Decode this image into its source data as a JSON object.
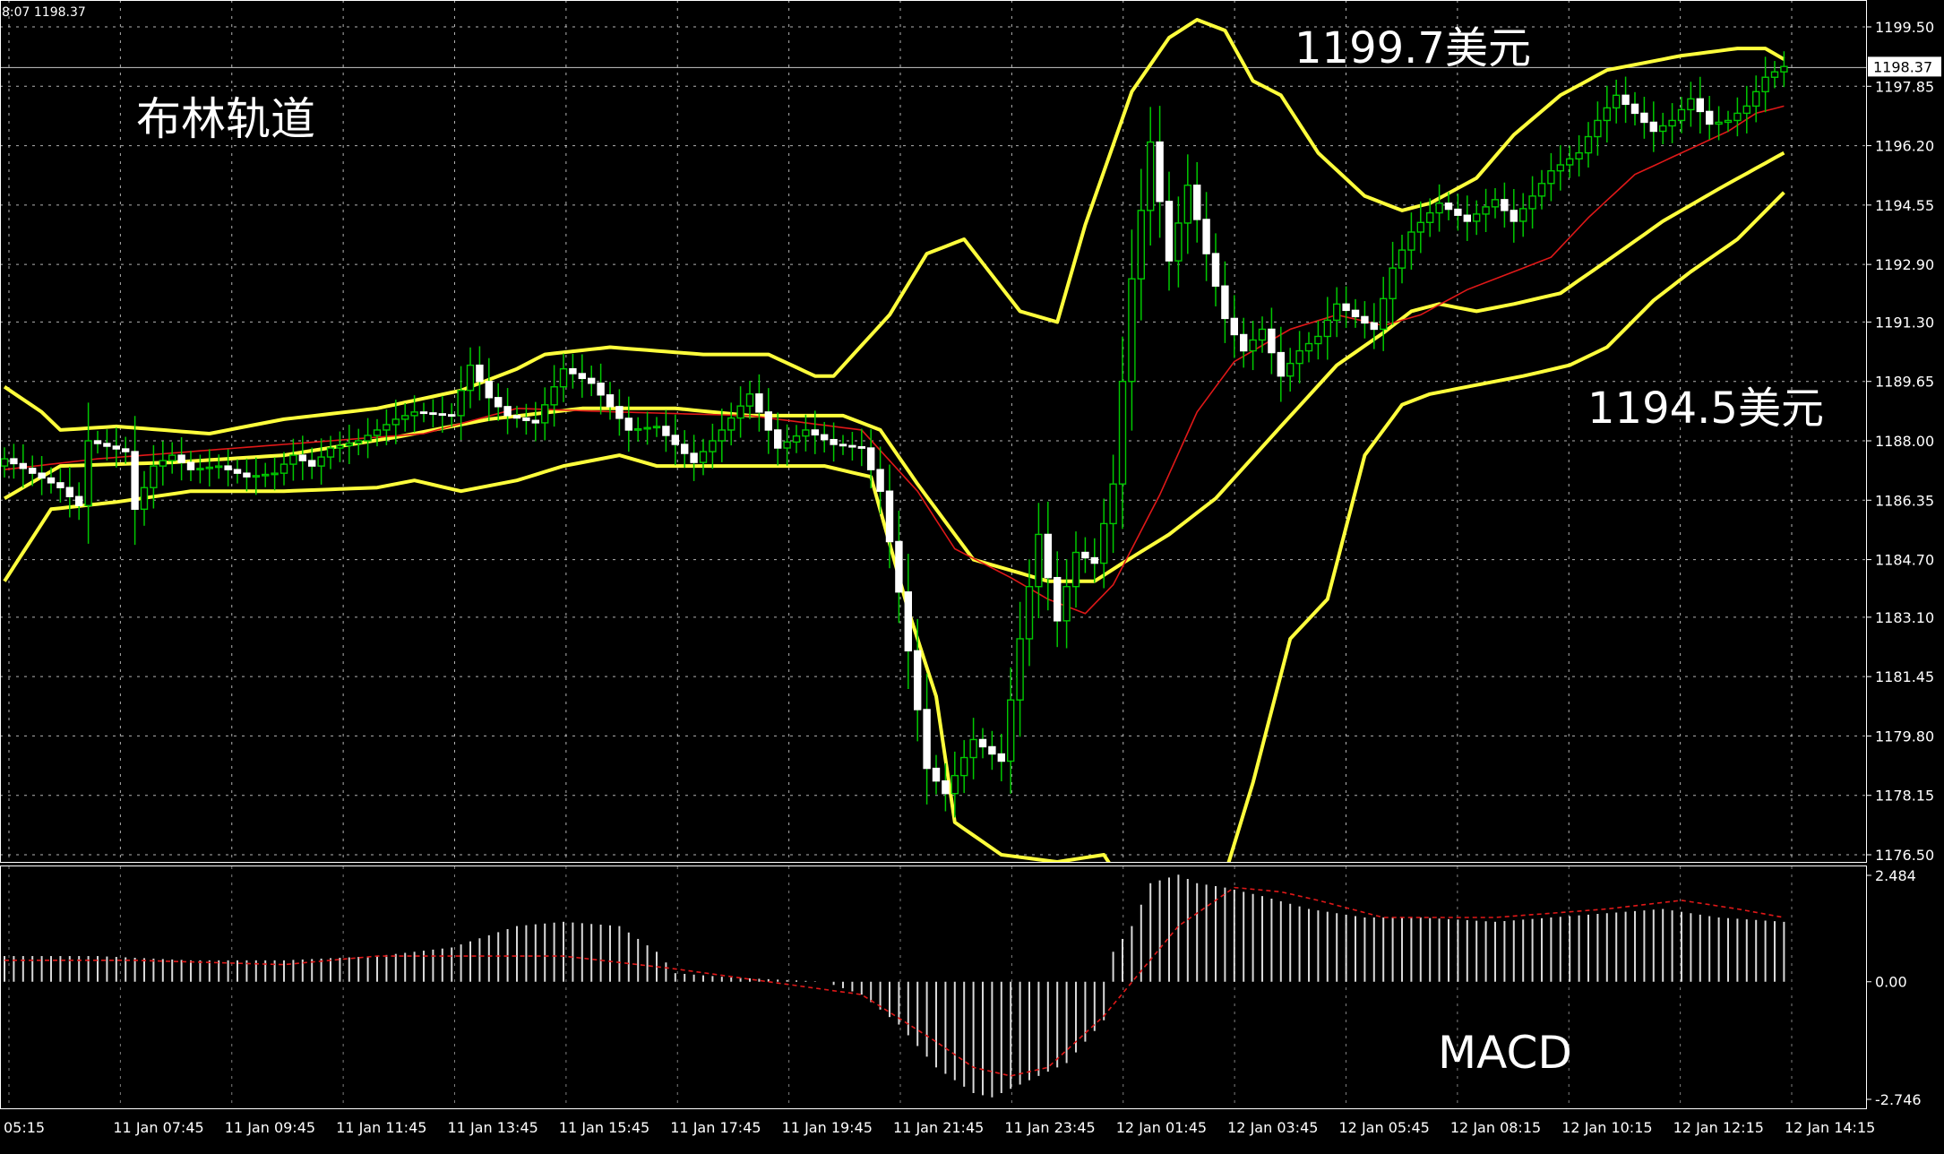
{
  "header": {
    "info": "8:07 1198.37"
  },
  "annotations": {
    "title": "布林轨道",
    "upper_label": "1199.7美元",
    "lower_label": "1194.5美元",
    "macd_label": "MACD"
  },
  "colors": {
    "background": "#000000",
    "grid": "#FFFFFF",
    "candle_up": "#00C800",
    "candle_down": "#FFFFFF",
    "bands": "#FFFF3C",
    "ma": "#E01818",
    "macd_hist": "#FFFFFF",
    "macd_signal": "#E01818",
    "axis_text": "#FFFFFF"
  },
  "chart_data": [
    {
      "type": "candlestick",
      "name": "price",
      "y_ticks": [
        "1199.50",
        "1197.85",
        "1196.20",
        "1194.55",
        "1192.90",
        "1191.30",
        "1189.65",
        "1188.00",
        "1186.35",
        "1184.70",
        "1183.10",
        "1181.45",
        "1179.80",
        "1178.15",
        "1176.50"
      ],
      "ylim": [
        1176.5,
        1199.5
      ],
      "current_price": "1198.37",
      "x_labels": [
        "05:15",
        "11 Jan 07:45",
        "11 Jan 09:45",
        "11 Jan 11:45",
        "11 Jan 13:45",
        "11 Jan 15:45",
        "11 Jan 17:45",
        "11 Jan 19:45",
        "11 Jan 21:45",
        "11 Jan 23:45",
        "12 Jan 01:45",
        "12 Jan 03:45",
        "12 Jan 05:45",
        "12 Jan 08:15",
        "12 Jan 10:15",
        "12 Jan 12:15",
        "12 Jan 14:15"
      ],
      "bands": {
        "upper_keys": [
          [
            0,
            1189.5
          ],
          [
            4,
            1188.8
          ],
          [
            6,
            1188.3
          ],
          [
            12,
            1188.4
          ],
          [
            22,
            1188.2
          ],
          [
            30,
            1188.6
          ],
          [
            40,
            1188.9
          ],
          [
            49,
            1189.4
          ],
          [
            55,
            1190.0
          ],
          [
            58,
            1190.4
          ],
          [
            65,
            1190.6
          ],
          [
            75,
            1190.4
          ],
          [
            82,
            1190.4
          ],
          [
            87,
            1189.8
          ],
          [
            89,
            1189.8
          ],
          [
            95,
            1191.5
          ],
          [
            99,
            1193.2
          ],
          [
            103,
            1193.6
          ],
          [
            109,
            1191.6
          ],
          [
            113,
            1191.3
          ],
          [
            116,
            1194.0
          ],
          [
            121,
            1197.7
          ],
          [
            125,
            1199.2
          ],
          [
            128,
            1199.7
          ],
          [
            131,
            1199.4
          ],
          [
            134,
            1198.0
          ],
          [
            137,
            1197.6
          ],
          [
            141,
            1196.0
          ],
          [
            146,
            1194.8
          ],
          [
            150,
            1194.4
          ],
          [
            153,
            1194.6
          ],
          [
            158,
            1195.3
          ],
          [
            162,
            1196.5
          ],
          [
            167,
            1197.6
          ],
          [
            172,
            1198.3
          ],
          [
            180,
            1198.7
          ],
          [
            186,
            1198.9
          ],
          [
            189,
            1198.9
          ],
          [
            191,
            1198.6
          ]
        ],
        "middle_keys": [
          [
            0,
            1186.4
          ],
          [
            6,
            1187.3
          ],
          [
            18,
            1187.4
          ],
          [
            30,
            1187.6
          ],
          [
            42,
            1188.1
          ],
          [
            52,
            1188.6
          ],
          [
            62,
            1188.9
          ],
          [
            72,
            1188.9
          ],
          [
            80,
            1188.7
          ],
          [
            90,
            1188.7
          ],
          [
            94,
            1188.3
          ],
          [
            98,
            1186.8
          ],
          [
            104,
            1184.7
          ],
          [
            112,
            1184.1
          ],
          [
            117,
            1184.1
          ],
          [
            120,
            1184.6
          ],
          [
            125,
            1185.4
          ],
          [
            130,
            1186.4
          ],
          [
            137,
            1188.4
          ],
          [
            143,
            1190.1
          ],
          [
            148,
            1191.0
          ],
          [
            151,
            1191.6
          ],
          [
            154,
            1191.8
          ],
          [
            158,
            1191.6
          ],
          [
            162,
            1191.8
          ],
          [
            167,
            1192.1
          ],
          [
            172,
            1193.0
          ],
          [
            178,
            1194.1
          ],
          [
            184,
            1195.0
          ],
          [
            191,
            1196.0
          ]
        ],
        "lower_keys": [
          [
            0,
            1184.1
          ],
          [
            5,
            1186.1
          ],
          [
            12,
            1186.3
          ],
          [
            20,
            1186.6
          ],
          [
            30,
            1186.6
          ],
          [
            40,
            1186.7
          ],
          [
            44,
            1186.9
          ],
          [
            49,
            1186.6
          ],
          [
            55,
            1186.9
          ],
          [
            60,
            1187.3
          ],
          [
            66,
            1187.6
          ],
          [
            70,
            1187.3
          ],
          [
            78,
            1187.3
          ],
          [
            88,
            1187.3
          ],
          [
            93,
            1187.0
          ],
          [
            97,
            1183.3
          ],
          [
            100,
            1180.9
          ],
          [
            102,
            1177.4
          ],
          [
            107,
            1176.5
          ],
          [
            113,
            1176.3
          ],
          [
            118,
            1176.5
          ],
          [
            121,
            1175.3
          ],
          [
            125,
            1174.9
          ],
          [
            130,
            1175.1
          ],
          [
            134,
            1178.5
          ],
          [
            138,
            1182.5
          ],
          [
            142,
            1183.6
          ],
          [
            146,
            1187.6
          ],
          [
            150,
            1189.0
          ],
          [
            153,
            1189.3
          ],
          [
            157,
            1189.5
          ],
          [
            163,
            1189.8
          ],
          [
            168,
            1190.1
          ],
          [
            172,
            1190.6
          ],
          [
            177,
            1191.9
          ],
          [
            181,
            1192.7
          ],
          [
            186,
            1193.6
          ],
          [
            191,
            1194.9
          ]
        ]
      },
      "ma_keys": [
        [
          0,
          1187.2
        ],
        [
          10,
          1187.5
        ],
        [
          30,
          1187.9
        ],
        [
          45,
          1188.2
        ],
        [
          55,
          1188.9
        ],
        [
          66,
          1188.8
        ],
        [
          80,
          1188.7
        ],
        [
          92,
          1188.3
        ],
        [
          98,
          1186.6
        ],
        [
          102,
          1185.0
        ],
        [
          108,
          1184.2
        ],
        [
          112,
          1183.6
        ],
        [
          116,
          1183.2
        ],
        [
          119,
          1184.0
        ],
        [
          124,
          1186.5
        ],
        [
          128,
          1188.8
        ],
        [
          132,
          1190.2
        ],
        [
          138,
          1191.1
        ],
        [
          143,
          1191.5
        ],
        [
          148,
          1191.2
        ],
        [
          152,
          1191.5
        ],
        [
          157,
          1192.2
        ],
        [
          162,
          1192.7
        ],
        [
          166,
          1193.1
        ],
        [
          170,
          1194.2
        ],
        [
          175,
          1195.4
        ],
        [
          180,
          1196.0
        ],
        [
          185,
          1196.6
        ],
        [
          188,
          1197.1
        ],
        [
          191,
          1197.3
        ]
      ],
      "candle_keys": [
        [
          0,
          1187.5
        ],
        [
          6,
          1186.7
        ],
        [
          8,
          1186.2
        ],
        [
          9,
          1188.0
        ],
        [
          13,
          1187.7
        ],
        [
          14,
          1186.1
        ],
        [
          16,
          1187.3
        ],
        [
          18,
          1187.6
        ],
        [
          20,
          1187.2
        ],
        [
          23,
          1187.3
        ],
        [
          26,
          1187.0
        ],
        [
          29,
          1187.1
        ],
        [
          31,
          1187.6
        ],
        [
          33,
          1187.3
        ],
        [
          35,
          1187.8
        ],
        [
          38,
          1188.0
        ],
        [
          42,
          1188.6
        ],
        [
          44,
          1188.8
        ],
        [
          48,
          1188.7
        ],
        [
          50,
          1190.1
        ],
        [
          52,
          1189.2
        ],
        [
          54,
          1188.7
        ],
        [
          57,
          1188.5
        ],
        [
          60,
          1190.0
        ],
        [
          63,
          1189.6
        ],
        [
          67,
          1188.3
        ],
        [
          70,
          1188.4
        ],
        [
          74,
          1187.4
        ],
        [
          77,
          1188.3
        ],
        [
          80,
          1189.3
        ],
        [
          83,
          1187.8
        ],
        [
          86,
          1188.3
        ],
        [
          89,
          1187.9
        ],
        [
          92,
          1187.8
        ],
        [
          94,
          1186.6
        ],
        [
          96,
          1183.8
        ],
        [
          99,
          1178.9
        ],
        [
          101,
          1178.2
        ],
        [
          104,
          1179.7
        ],
        [
          107,
          1179.1
        ],
        [
          109,
          1182.5
        ],
        [
          111,
          1185.4
        ],
        [
          113,
          1183.0
        ],
        [
          115,
          1184.9
        ],
        [
          117,
          1184.6
        ],
        [
          119,
          1186.8
        ],
        [
          121,
          1192.5
        ],
        [
          123,
          1196.3
        ],
        [
          125,
          1193.0
        ],
        [
          127,
          1195.1
        ],
        [
          129,
          1193.2
        ],
        [
          131,
          1191.4
        ],
        [
          133,
          1190.5
        ],
        [
          135,
          1191.1
        ],
        [
          137,
          1189.8
        ],
        [
          139,
          1190.5
        ],
        [
          141,
          1190.9
        ],
        [
          143,
          1191.8
        ],
        [
          147,
          1191.1
        ],
        [
          149,
          1192.8
        ],
        [
          151,
          1193.8
        ],
        [
          154,
          1194.6
        ],
        [
          157,
          1194.1
        ],
        [
          160,
          1194.7
        ],
        [
          162,
          1194.1
        ],
        [
          164,
          1194.8
        ],
        [
          166,
          1195.5
        ],
        [
          169,
          1196.0
        ],
        [
          171,
          1196.9
        ],
        [
          173,
          1197.6
        ],
        [
          175,
          1197.1
        ],
        [
          177,
          1196.6
        ],
        [
          179,
          1196.9
        ],
        [
          181,
          1197.5
        ],
        [
          183,
          1196.8
        ],
        [
          185,
          1196.9
        ],
        [
          187,
          1197.3
        ],
        [
          189,
          1198.1
        ],
        [
          191,
          1198.4
        ]
      ]
    },
    {
      "type": "bar",
      "name": "MACD",
      "y_ticks": [
        "2.484",
        "0.00",
        "-2.746"
      ],
      "ylim": [
        -2.746,
        2.484
      ],
      "hist_keys": [
        [
          0,
          0.6
        ],
        [
          10,
          0.6
        ],
        [
          20,
          0.5
        ],
        [
          30,
          0.5
        ],
        [
          40,
          0.6
        ],
        [
          48,
          0.8
        ],
        [
          55,
          1.3
        ],
        [
          60,
          1.4
        ],
        [
          66,
          1.3
        ],
        [
          70,
          0.7
        ],
        [
          72,
          0.2
        ],
        [
          78,
          0.1
        ],
        [
          88,
          0.0
        ],
        [
          92,
          -0.3
        ],
        [
          96,
          -1.0
        ],
        [
          100,
          -2.0
        ],
        [
          104,
          -2.6
        ],
        [
          106,
          -2.7
        ],
        [
          110,
          -2.3
        ],
        [
          114,
          -1.9
        ],
        [
          118,
          -0.9
        ],
        [
          119,
          0.7
        ],
        [
          121,
          1.3
        ],
        [
          123,
          2.3
        ],
        [
          126,
          2.5
        ],
        [
          128,
          2.3
        ],
        [
          131,
          2.2
        ],
        [
          135,
          2.0
        ],
        [
          140,
          1.7
        ],
        [
          146,
          1.5
        ],
        [
          152,
          1.5
        ],
        [
          160,
          1.4
        ],
        [
          166,
          1.5
        ],
        [
          172,
          1.6
        ],
        [
          178,
          1.7
        ],
        [
          184,
          1.5
        ],
        [
          191,
          1.4
        ]
      ],
      "signal_keys": [
        [
          0,
          0.5
        ],
        [
          14,
          0.5
        ],
        [
          30,
          0.4
        ],
        [
          40,
          0.6
        ],
        [
          60,
          0.6
        ],
        [
          72,
          0.3
        ],
        [
          82,
          0.0
        ],
        [
          92,
          -0.3
        ],
        [
          100,
          -1.4
        ],
        [
          104,
          -2.0
        ],
        [
          108,
          -2.2
        ],
        [
          112,
          -2.0
        ],
        [
          118,
          -0.8
        ],
        [
          126,
          1.3
        ],
        [
          132,
          2.2
        ],
        [
          137,
          2.1
        ],
        [
          141,
          1.9
        ],
        [
          148,
          1.5
        ],
        [
          160,
          1.5
        ],
        [
          172,
          1.7
        ],
        [
          180,
          1.9
        ],
        [
          186,
          1.7
        ],
        [
          191,
          1.5
        ]
      ]
    }
  ]
}
